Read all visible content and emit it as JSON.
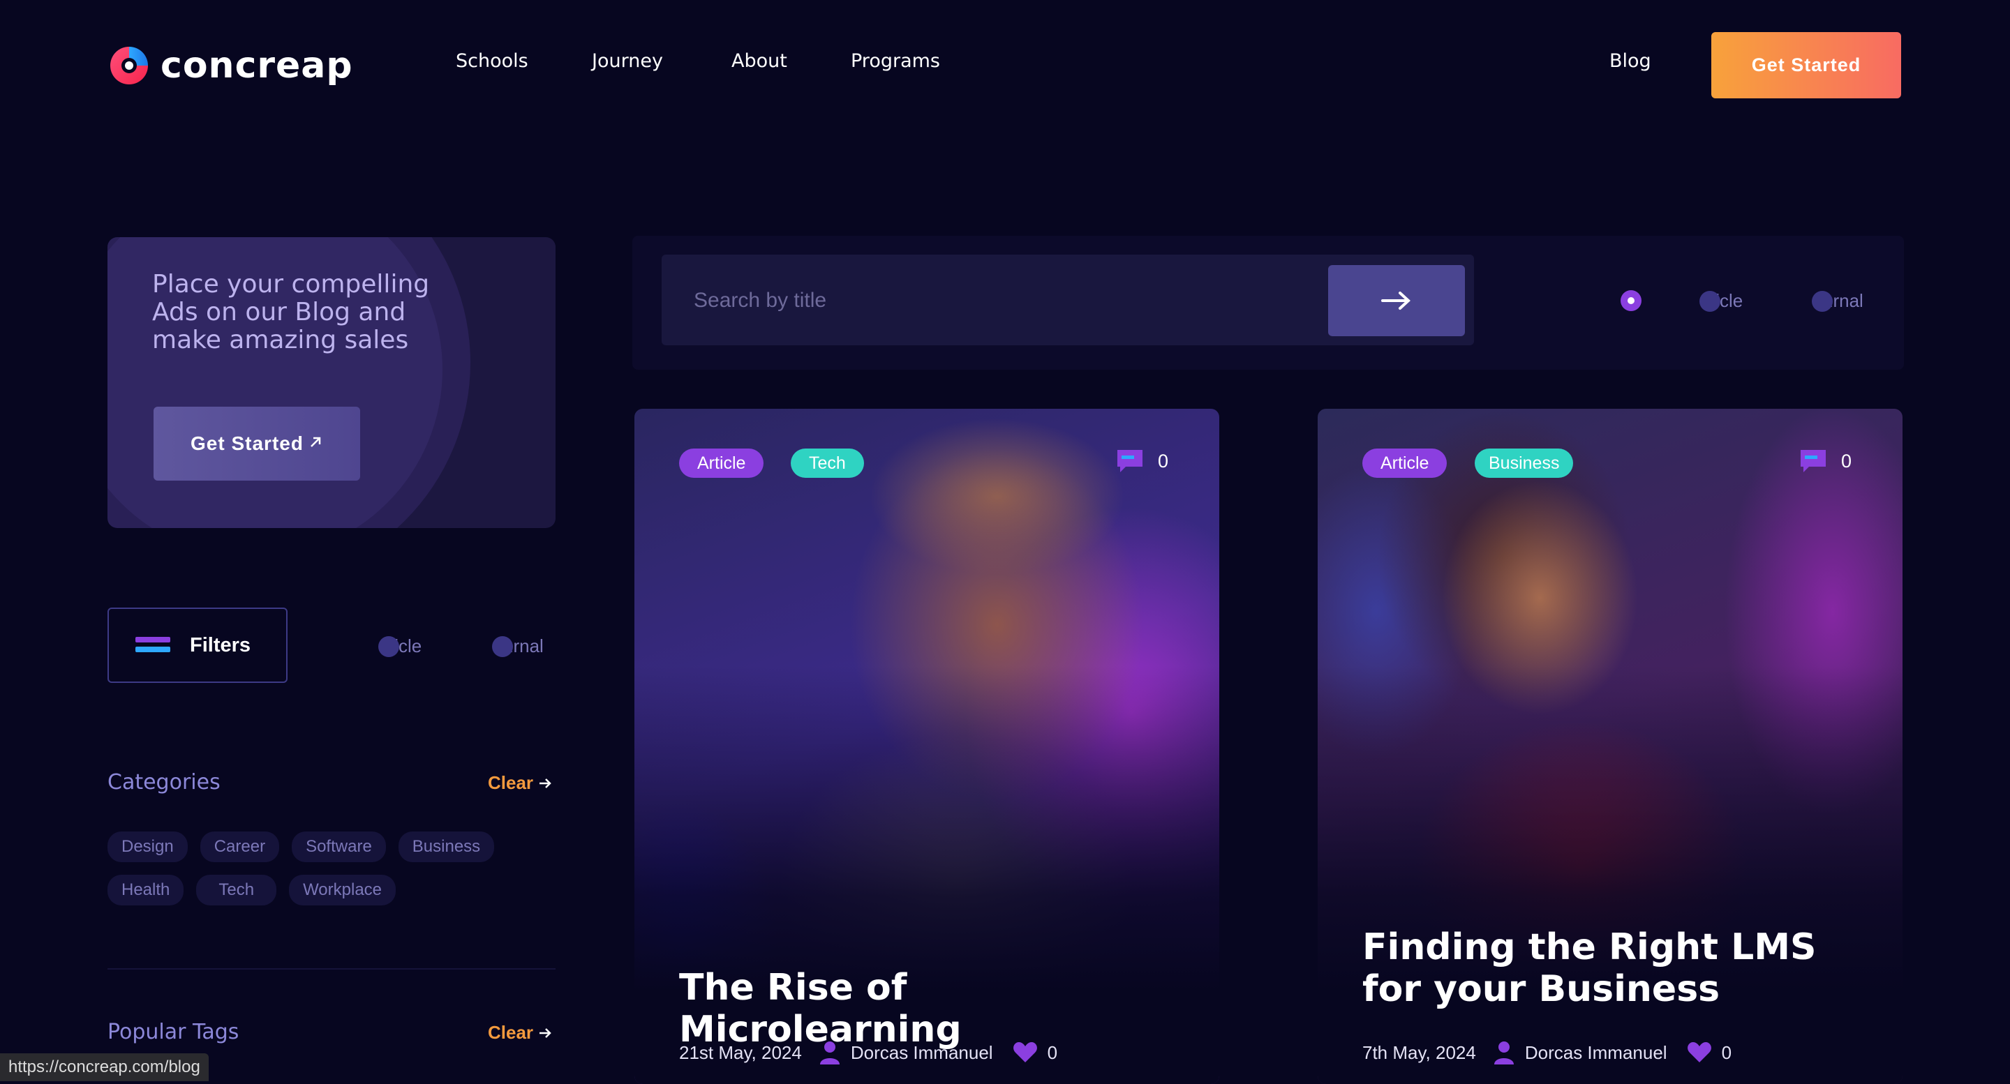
{
  "header": {
    "brand": "concreap",
    "nav": [
      "Schools",
      "Journey",
      "About",
      "Programs"
    ],
    "blog_link": "Blog",
    "cta": "Get Started"
  },
  "ad": {
    "text": "Place your compelling Ads on our Blog and make amazing sales",
    "button": "Get Started"
  },
  "filters": {
    "button": "Filters",
    "options": [
      "ticle",
      "urnal"
    ]
  },
  "categories": {
    "title": "Categories",
    "clear": "Clear",
    "items": [
      "Design",
      "Career",
      "Software",
      "Business",
      "Health",
      "Tech",
      "Workplace"
    ]
  },
  "popular_tags": {
    "title": "Popular Tags",
    "clear": "Clear"
  },
  "search": {
    "placeholder": "Search by title",
    "options": [
      "ticle",
      "urnal"
    ]
  },
  "posts": [
    {
      "tags": [
        "Article",
        "Tech"
      ],
      "comments": "0",
      "title": "The Rise of Microlearning",
      "date": "21st May, 2024",
      "author": "Dorcas Immanuel",
      "likes": "0"
    },
    {
      "tags": [
        "Article",
        "Business"
      ],
      "comments": "0",
      "title": "Finding the Right LMS for your Business",
      "date": "7th May, 2024",
      "author": "Dorcas Immanuel",
      "likes": "0"
    }
  ],
  "status_url": "https://concreap.com/blog",
  "colors": {
    "background": "#070620",
    "cta_gradient_start": "#f8a23b",
    "cta_gradient_end": "#f86b62",
    "tag_article": "#8b3fe0",
    "tag_tech": "#2fd3c2",
    "accent_orange": "#f39a3e"
  }
}
